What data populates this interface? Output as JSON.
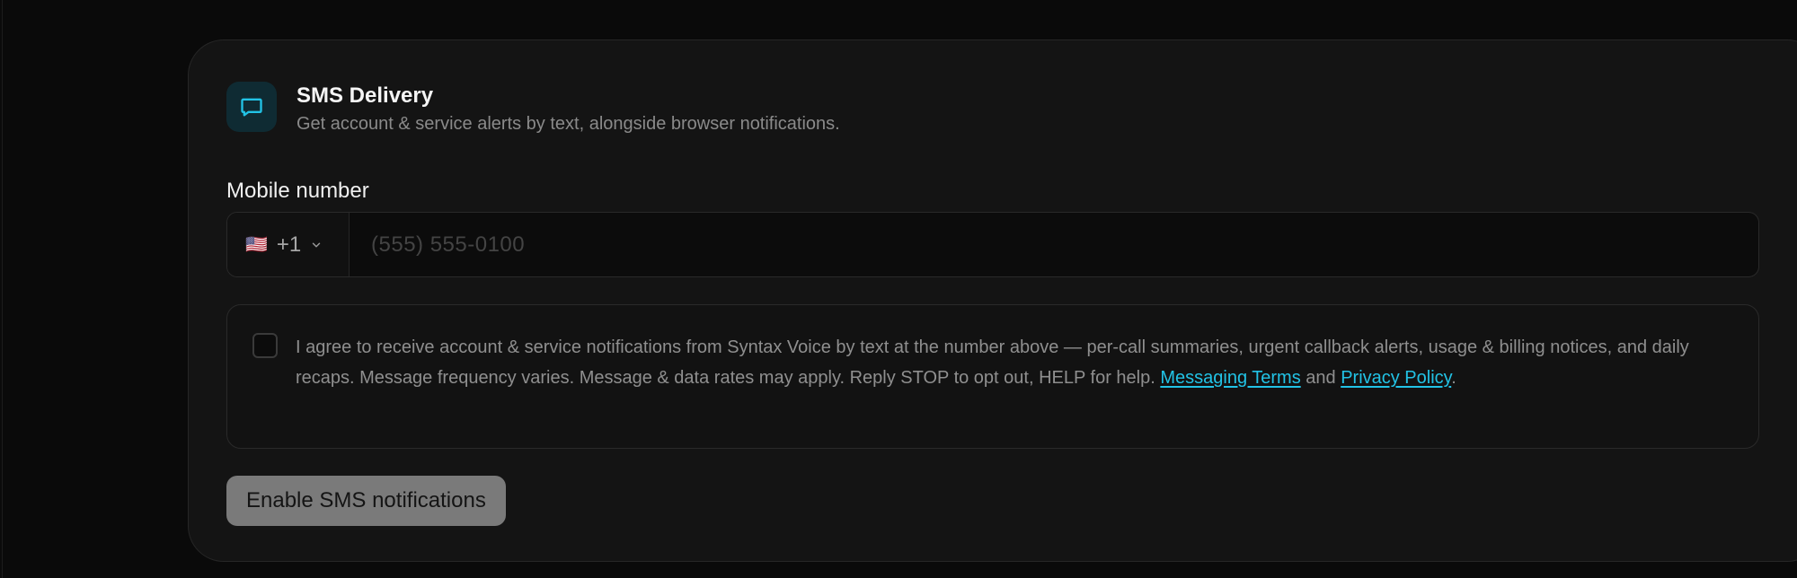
{
  "section": {
    "icon": "message-square-icon",
    "title": "SMS Delivery",
    "subtitle": "Get account & service alerts by text, alongside browser notifications."
  },
  "phone": {
    "label": "Mobile number",
    "country_flag": "🇺🇸",
    "country_code": "+1",
    "placeholder": "(555) 555-0100",
    "value": ""
  },
  "consent": {
    "checked": false,
    "text_before": "I agree to receive account & service notifications from Syntax Voice by text at the number above — per-call summaries, urgent callback alerts, usage & billing notices, and daily recaps. Message frequency varies. Message & data rates may apply. Reply STOP to opt out, HELP for help. ",
    "terms_link": "Messaging Terms",
    "and_text": " and ",
    "privacy_link": "Privacy Policy",
    "end_text": "."
  },
  "action": {
    "enable_label": "Enable SMS notifications"
  },
  "colors": {
    "accent": "#22c3e6",
    "card_bg": "#141414",
    "button_disabled": "#7a7a7a"
  }
}
